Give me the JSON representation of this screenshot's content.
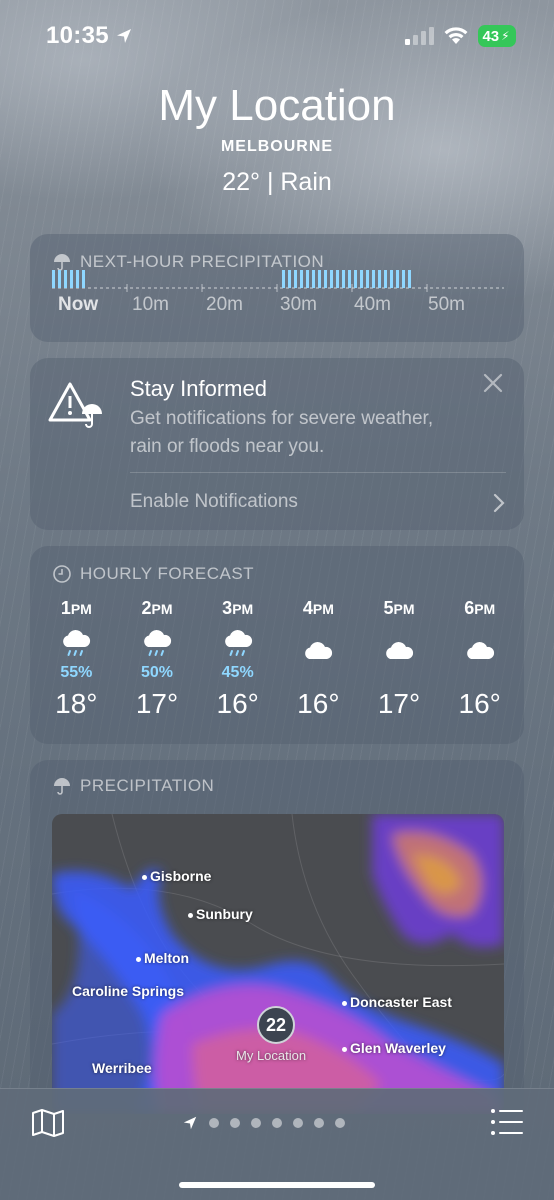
{
  "status_bar": {
    "time": "10:35",
    "battery": "43",
    "location_icon": "location-arrow-icon",
    "signal_icon": "cellular-signal-icon",
    "wifi_icon": "wifi-icon"
  },
  "header": {
    "title": "My Location",
    "city": "MELBOURNE",
    "condition": "22°  |  Rain"
  },
  "next_hour": {
    "title": "NEXT-HOUR PRECIPITATION",
    "icon": "umbrella-icon",
    "ticks": [
      "Now",
      "10m",
      "20m",
      "30m",
      "40m",
      "50m"
    ]
  },
  "stay_informed": {
    "title": "Stay Informed",
    "body": "Get notifications for severe weather, rain or floods near you.",
    "link": "Enable Notifications",
    "icon": "warning-umbrella-icon"
  },
  "hourly": {
    "title": "HOURLY FORECAST",
    "icon": "clock-icon",
    "hours": [
      {
        "time": "1",
        "suffix": "PM",
        "icon": "cloud-rain-icon",
        "pct": "55%",
        "temp": "18°"
      },
      {
        "time": "2",
        "suffix": "PM",
        "icon": "cloud-rain-icon",
        "pct": "50%",
        "temp": "17°"
      },
      {
        "time": "3",
        "suffix": "PM",
        "icon": "cloud-rain-icon",
        "pct": "45%",
        "temp": "16°"
      },
      {
        "time": "4",
        "suffix": "PM",
        "icon": "cloud-icon",
        "pct": "",
        "temp": "16°"
      },
      {
        "time": "5",
        "suffix": "PM",
        "icon": "cloud-icon",
        "pct": "",
        "temp": "17°"
      },
      {
        "time": "6",
        "suffix": "PM",
        "icon": "cloud-icon",
        "pct": "",
        "temp": "16°"
      }
    ]
  },
  "precipitation": {
    "title": "PRECIPITATION",
    "icon": "umbrella-icon",
    "places": [
      "Gisborne",
      "Sunbury",
      "Melton",
      "Caroline Springs",
      "Doncaster East",
      "Glen Waverley",
      "Werribee"
    ],
    "current_temp": "22",
    "current_label": "My Location"
  },
  "bottom_bar": {
    "map_icon": "map-icon",
    "list_icon": "list-icon",
    "page_count": 7
  },
  "colors": {
    "precip_blue": "#8fd7ff",
    "battery_green": "#35c759"
  }
}
